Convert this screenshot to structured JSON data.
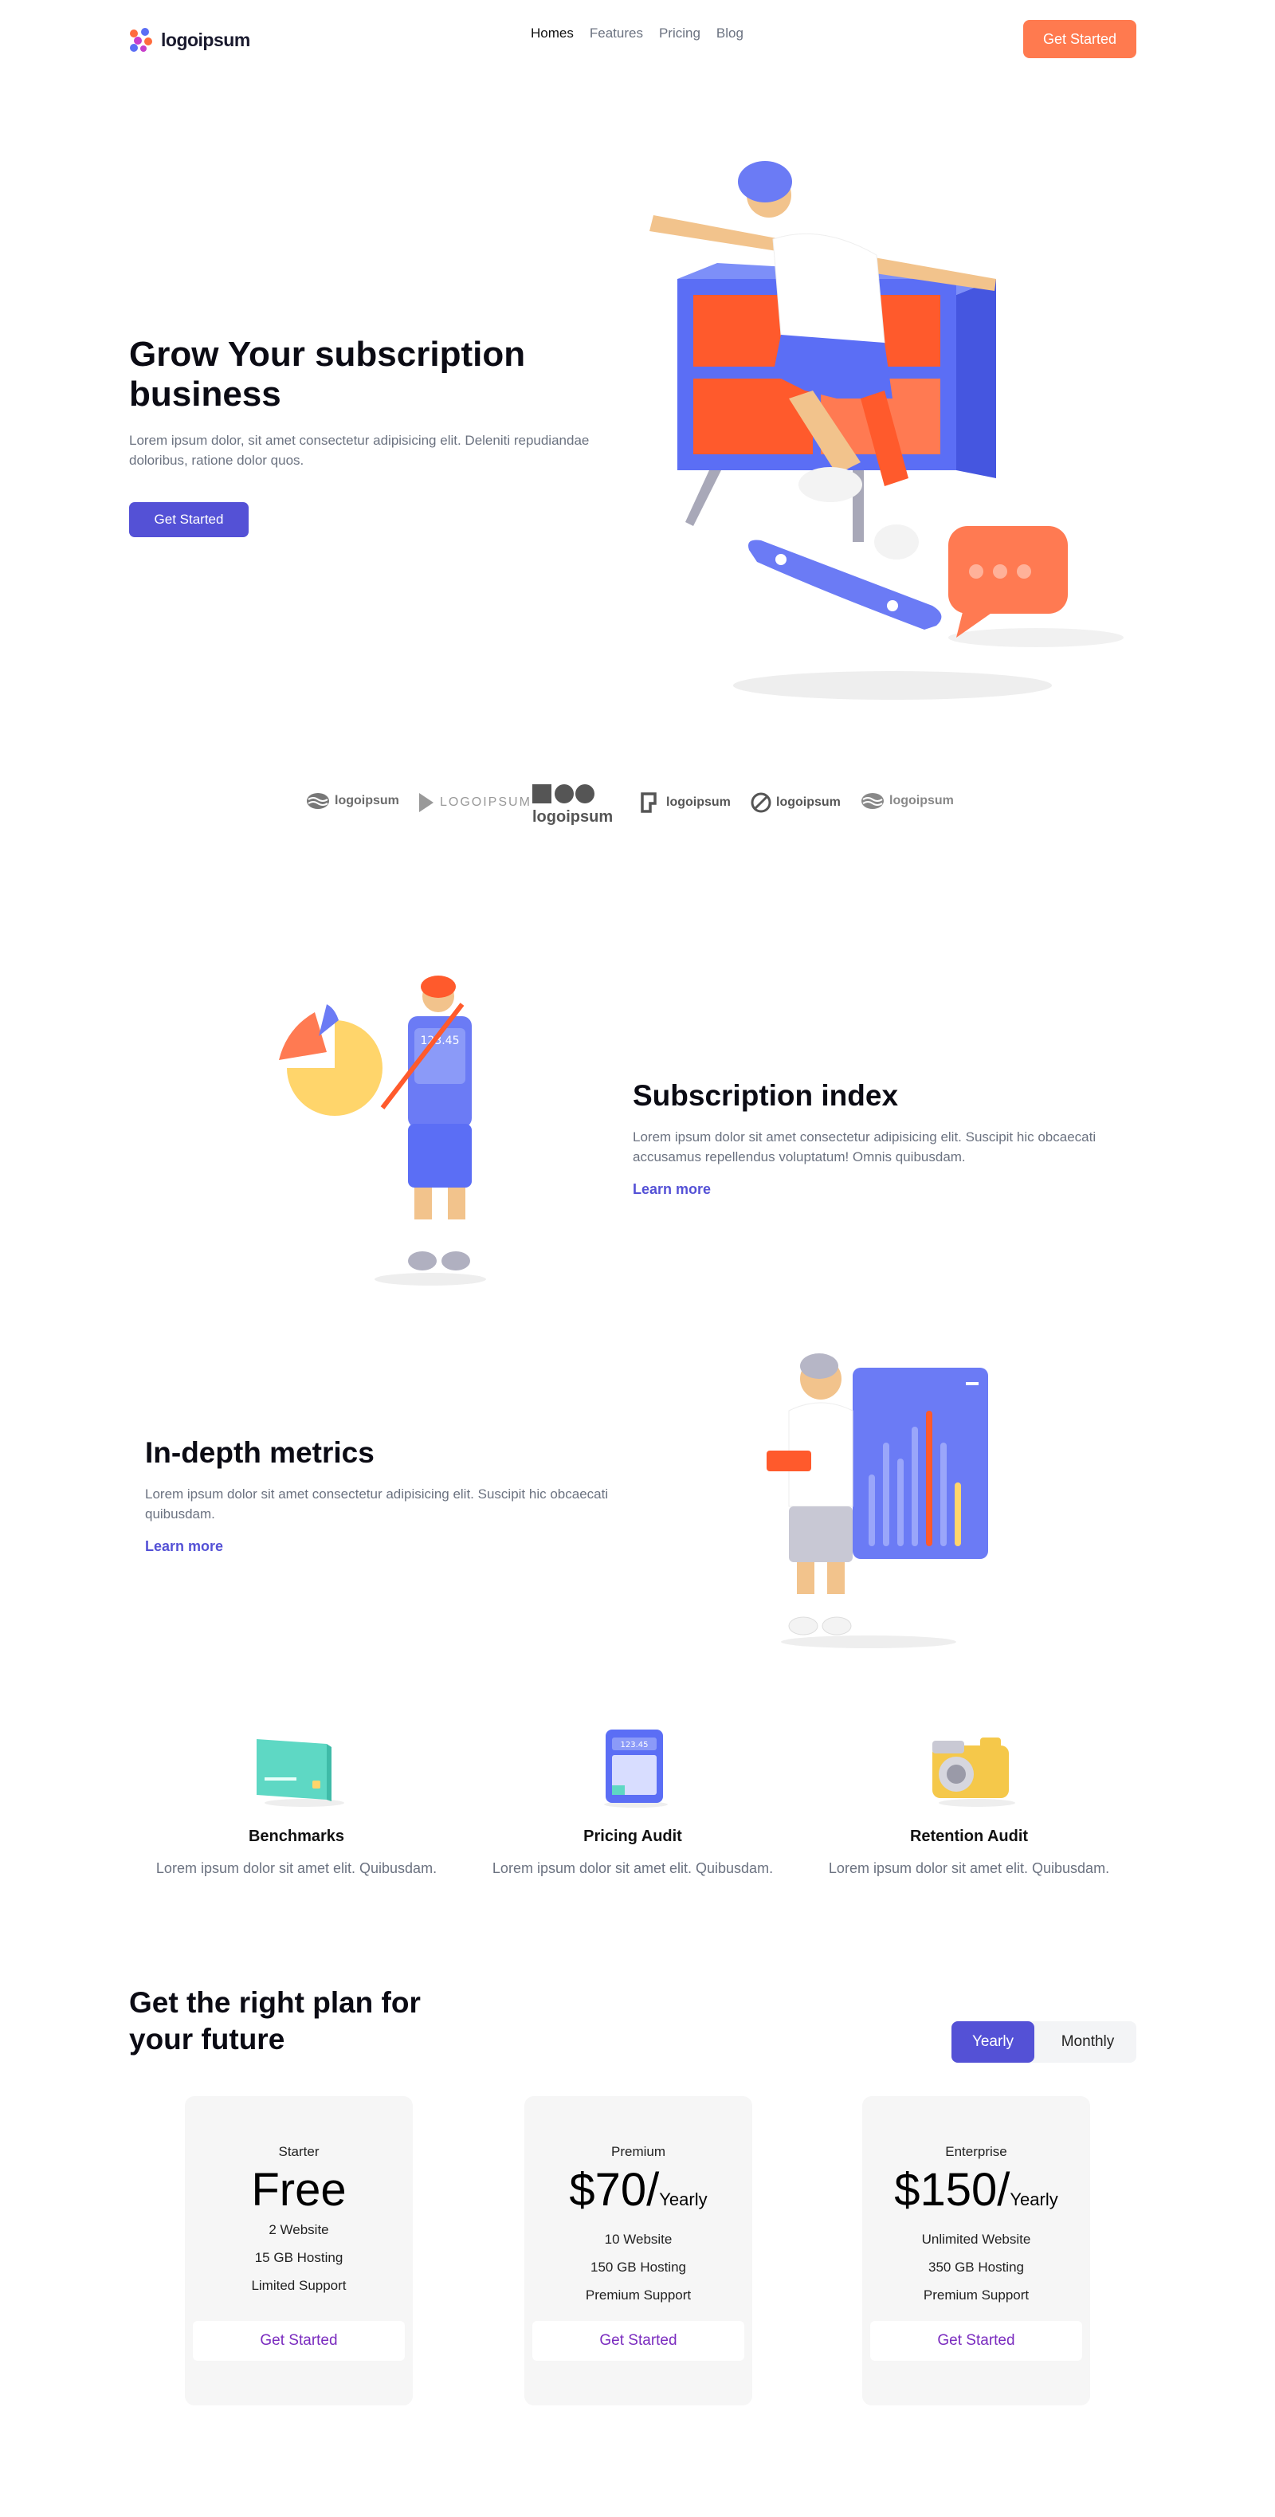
{
  "nav": {
    "logo_text": "logoipsum",
    "links": [
      "Homes",
      "Features",
      "Pricing",
      "Blog"
    ],
    "cta": "Get Started"
  },
  "hero": {
    "title": "Grow Your subscription business",
    "description": "Lorem ipsum dolor, sit amet consectetur adipisicing elit. Deleniti repudiandae doloribus, ratione dolor quos.",
    "button": "Get Started"
  },
  "brands": [
    "logoipsum",
    "LOGOIPSUM",
    "logoipsum",
    "logoipsum",
    "logoipsum",
    "logoipsum"
  ],
  "features": [
    {
      "title": "Subscription index",
      "description": "Lorem ipsum dolor sit amet consectetur adipisicing elit. Suscipit hic obcaecati accusamus repellendus voluptatum! Omnis quibusdam.",
      "link": "Learn more"
    },
    {
      "title": "In-depth metrics",
      "description": "Lorem ipsum dolor sit amet consectetur adipisicing elit. Suscipit hic obcaecati quibusdam.",
      "link": "Learn more"
    }
  ],
  "minis": [
    {
      "title": "Benchmarks",
      "description": "Lorem ipsum dolor sit amet elit. Quibusdam.",
      "icon": "credit-card-icon"
    },
    {
      "title": "Pricing Audit",
      "description": "Lorem ipsum dolor sit amet elit. Quibusdam.",
      "icon": "calculator-icon"
    },
    {
      "title": "Retention Audit",
      "description": "Lorem ipsum dolor sit amet elit. Quibusdam.",
      "icon": "camera-icon"
    }
  ],
  "pricing": {
    "title": "Get the right plan for your future",
    "toggle": {
      "yearly": "Yearly",
      "monthly": "Monthly",
      "selected": "Yearly"
    },
    "plans": [
      {
        "name": "Starter",
        "price": "Free",
        "period": "",
        "features": [
          "2 Website",
          "15 GB Hosting",
          "Limited Support"
        ],
        "button": "Get Started"
      },
      {
        "name": "Premium",
        "price": "$70/",
        "period": "Yearly",
        "features": [
          "10 Website",
          "150 GB Hosting",
          "Premium Support"
        ],
        "button": "Get Started"
      },
      {
        "name": "Enterprise",
        "price": "$150/",
        "period": "Yearly",
        "features": [
          "Unlimited Website",
          "350 GB Hosting",
          "Premium Support"
        ],
        "button": "Get Started"
      }
    ]
  },
  "colors": {
    "accent_orange": "#ff7a4f",
    "accent_purple": "#5451d6",
    "text_muted": "#6b7280"
  }
}
